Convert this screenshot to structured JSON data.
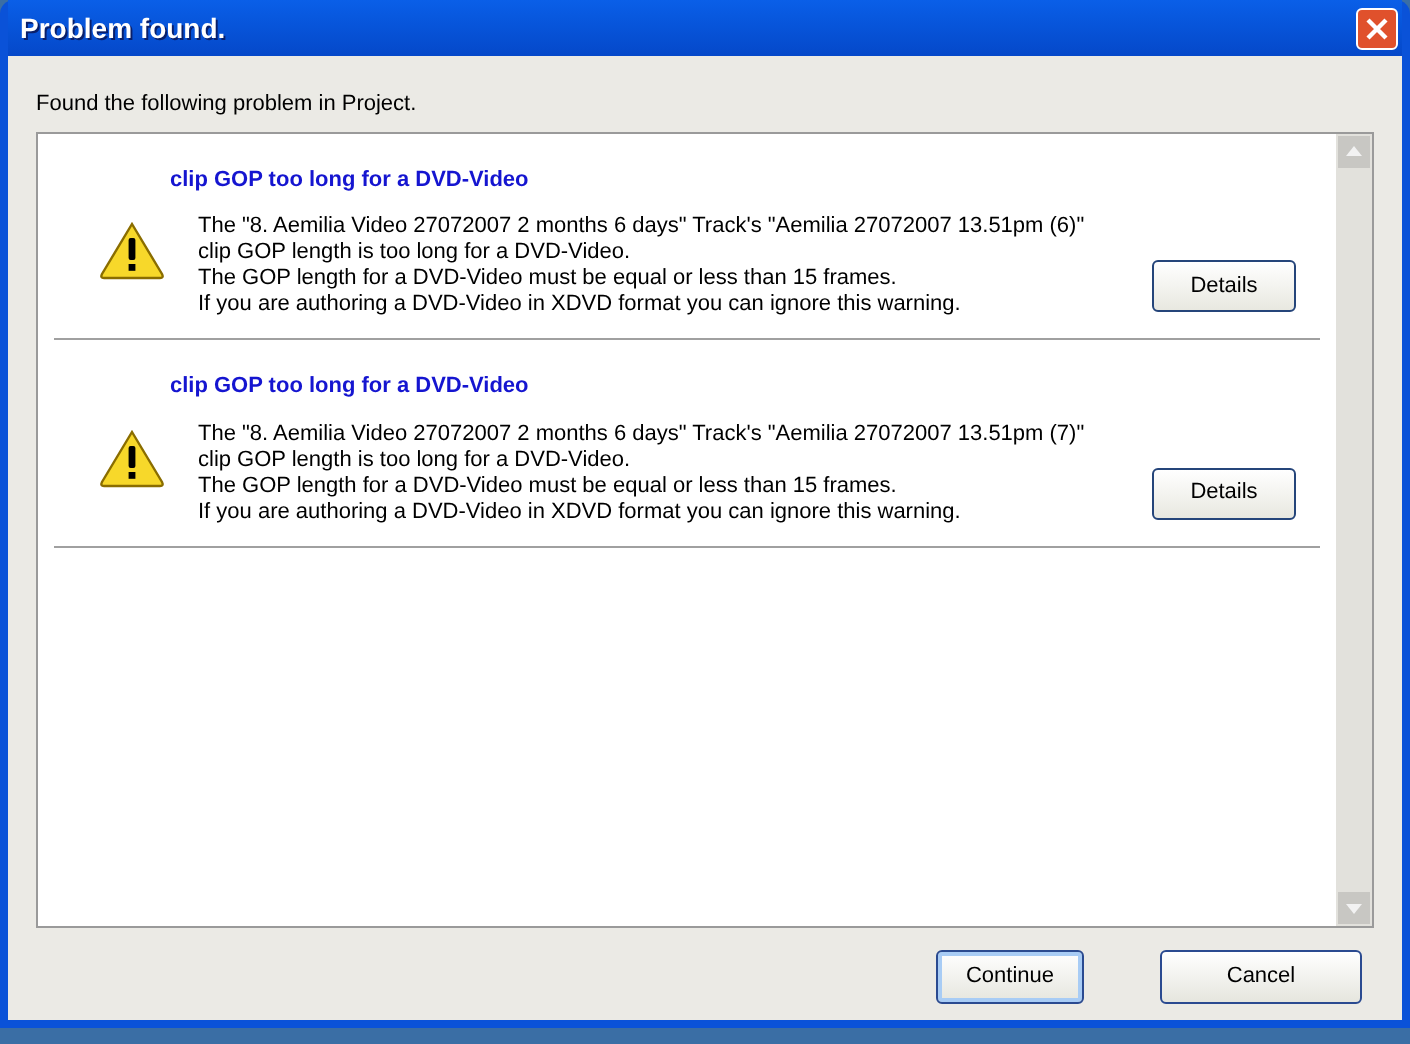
{
  "window": {
    "title": "Problem found."
  },
  "message": "Found the following problem in Project.",
  "problems": [
    {
      "title": "clip GOP too long for a DVD-Video",
      "lines": [
        "The \"8. Aemilia Video 27072007 2 months 6 days\" Track's \"Aemilia 27072007 13.51pm (6)\"",
        "clip GOP length is too long for a DVD-Video.",
        "The GOP length for a DVD-Video must be equal or less than 15 frames.",
        "If you are authoring a DVD-Video in XDVD format you can ignore this warning."
      ],
      "button": "Details"
    },
    {
      "title": "clip GOP too long for a DVD-Video",
      "lines": [
        "The \"8. Aemilia Video 27072007 2 months 6 days\" Track's \"Aemilia 27072007 13.51pm (7)\"",
        "clip GOP length is too long for a DVD-Video.",
        "The GOP length for a DVD-Video must be equal or less than 15 frames.",
        "If you are authoring a DVD-Video in XDVD format you can ignore this warning."
      ],
      "button": "Details"
    }
  ],
  "buttons": [
    {
      "label": "Continue",
      "default": true
    },
    {
      "label": "Cancel",
      "default": false
    }
  ]
}
